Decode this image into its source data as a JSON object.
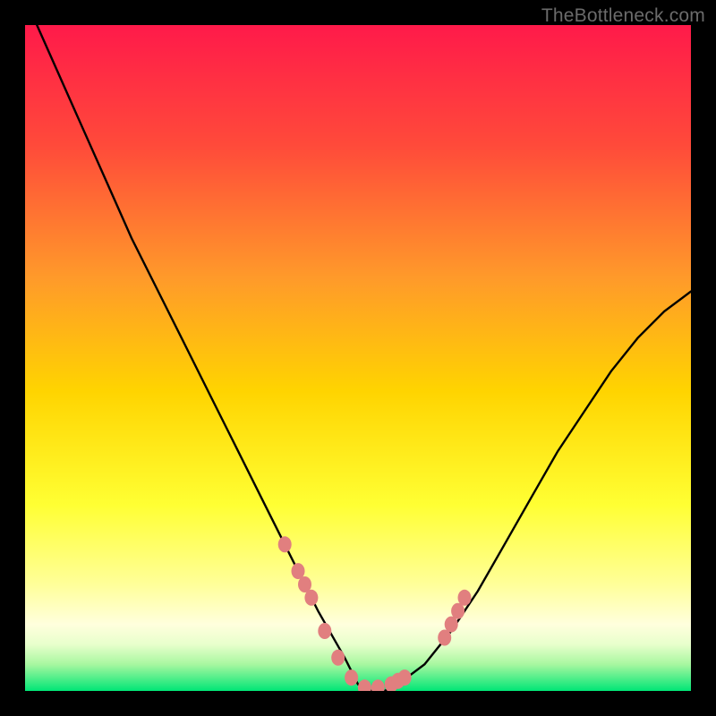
{
  "attribution": "TheBottleneck.com",
  "colors": {
    "frame": "#000000",
    "gradient_top": "#ff1a4a",
    "gradient_mid_upper": "#ff7a2a",
    "gradient_mid": "#ffd400",
    "gradient_lower": "#ffff66",
    "gradient_pale": "#ffffcc",
    "gradient_bottom": "#00e676",
    "curve": "#000000",
    "dot": "#e17f7f"
  },
  "chart_data": {
    "type": "line",
    "title": "",
    "xlabel": "",
    "ylabel": "",
    "xlim": [
      0,
      100
    ],
    "ylim": [
      0,
      100
    ],
    "series": [
      {
        "name": "bottleneck-curve",
        "x": [
          0,
          4,
          8,
          12,
          16,
          20,
          24,
          28,
          32,
          36,
          40,
          44,
          48,
          50,
          52,
          54,
          56,
          60,
          64,
          68,
          72,
          76,
          80,
          84,
          88,
          92,
          96,
          100
        ],
        "y": [
          104,
          95,
          86,
          77,
          68,
          60,
          52,
          44,
          36,
          28,
          20,
          12,
          5,
          1,
          0,
          0,
          1,
          4,
          9,
          15,
          22,
          29,
          36,
          42,
          48,
          53,
          57,
          60
        ]
      }
    ],
    "dots": {
      "name": "highlight-points",
      "x": [
        39,
        41,
        42,
        43,
        45,
        47,
        49,
        51,
        53,
        55,
        56,
        57,
        63,
        64,
        65,
        66
      ],
      "y": [
        22,
        18,
        16,
        14,
        9,
        5,
        2,
        0.5,
        0.5,
        1,
        1.5,
        2,
        8,
        10,
        12,
        14
      ]
    }
  }
}
